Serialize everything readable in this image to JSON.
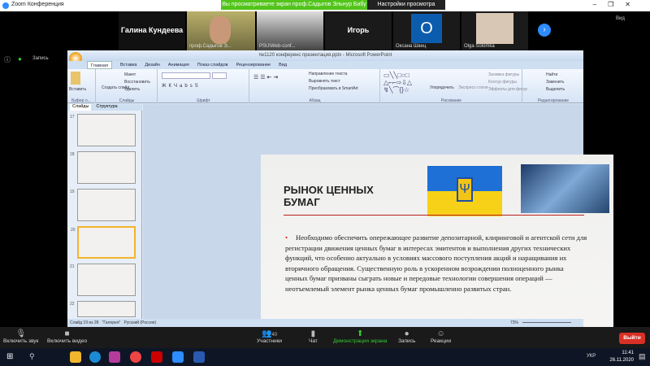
{
  "zoom": {
    "title": "Zoom Конференция",
    "banner": "Вы просматриваете экран проф.Садыгов Эльнур Бабу",
    "view_options": "Настройки просмотра",
    "view_label": "Вид",
    "participants": [
      {
        "name": "Галина Кундеева",
        "label": ""
      },
      {
        "name": "",
        "label": "проф.Садыгов Э..."
      },
      {
        "name": "",
        "label": "PSU\\Web-conf..."
      },
      {
        "name": "Игорь",
        "label": ""
      },
      {
        "name": "O",
        "label": "Оксана Швец"
      },
      {
        "name": "",
        "label": "Olga Solomka"
      }
    ],
    "toolbar": {
      "mute": "Включить звук",
      "video": "Включить видео",
      "participants": "Участники",
      "participants_count": "40",
      "chat": "Чат",
      "share": "Демонстрация экрана",
      "record": "Запись",
      "reactions": "Реакции",
      "leave": "Выйти"
    },
    "left_label": "Запись"
  },
  "ppt": {
    "title": "№1120 конференс презентация.pptx - Microsoft PowerPoint",
    "tabs": [
      "Главная",
      "Вставка",
      "Дизайн",
      "Анимация",
      "Показ слайдов",
      "Рецензирование",
      "Вид"
    ],
    "groups": {
      "clipboard": "Буфер о...",
      "paste": "Вставить",
      "slides": "Слайды",
      "new_slide": "Создать слайд",
      "layout": "Макет",
      "reset": "Восстановить",
      "delete": "Удалить",
      "font": "Шрифт",
      "paragraph": "Абзац",
      "text_dir": "Направление текста",
      "align_text": "Выровнять текст",
      "smartart": "Преобразовать в SmartArt",
      "drawing": "Рисование",
      "arrange": "Упорядочить",
      "quick_styles": "Экспресс-стили",
      "fill": "Заливка фигуры",
      "outline": "Контур фигуры",
      "effects": "Эффекты для фигур",
      "editing": "Редактирование",
      "find": "Найти",
      "replace": "Заменить",
      "select": "Выделить"
    },
    "pane_tabs": [
      "Слайды",
      "Структура"
    ],
    "thumb_numbers": [
      "17",
      "18",
      "19",
      "20",
      "21",
      "22"
    ],
    "slide": {
      "title": "РЫНОК ЦЕННЫХ БУМАГ",
      "body": "Необходимо обеспечить опережающее развитие депозитарной, клиринговой и агентской сети для регистрации движения ценных бумаг в интересах эмитентов и выполнения других технических функций, что особенно актуально в условиях массового поступления акций и наращивания их вторичного обращения. Существенную роль в ускоренном возрождении полноценного рынка ценных бумаг призваны сыграть новые и передовые технологии совершения операций — неотъемлемый элемент рынка ценных бумаг промышленно развитых стран."
    },
    "status": {
      "slide": "Слайд 19 из 28",
      "theme": "\"Галерея\"",
      "lang": "Русский (Россия)",
      "zoom": "73%"
    }
  },
  "taskbar": {
    "time": "11:41",
    "date": "26.11.2020",
    "lang": "УКР"
  }
}
